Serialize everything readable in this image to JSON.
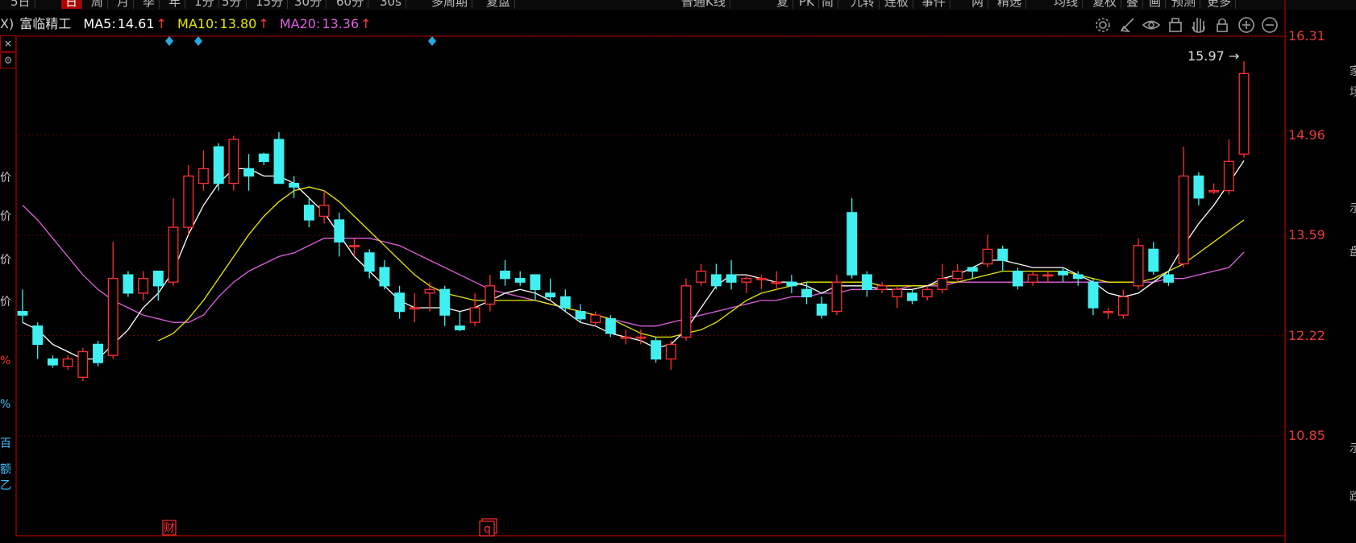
{
  "toolbar": {
    "period_items": [
      "5日",
      "日",
      "周",
      "月",
      "季",
      "年",
      "1分",
      "5分",
      "15分",
      "30分",
      "60分",
      "30s",
      "多周期",
      "复盘"
    ],
    "active_index": 1,
    "right_items": [
      "普通K线",
      "复",
      "PK",
      "简",
      "九转",
      "连板",
      "事件",
      "两",
      "精选",
      "均线",
      "复权",
      "叠",
      "画",
      "预测",
      "更多"
    ]
  },
  "legend": {
    "prefix": "X)",
    "stock_name": "富临精工",
    "ma5_label": "MA5:",
    "ma5_value": "14.61",
    "ma10_label": "MA10:",
    "ma10_value": "13.80",
    "ma20_label": "MA20:",
    "ma20_value": "13.36",
    "arrow": "↑",
    "colors": {
      "ma5": "#ffffff",
      "ma10": "#e8e800",
      "ma20": "#e060e0",
      "arrow": "#ff3b3b",
      "name": "#e0e0e0"
    }
  },
  "icons": [
    "settings-icon",
    "pen-icon",
    "eye-icon",
    "bag-icon",
    "hand-icon",
    "lock-icon",
    "zoom-in-icon",
    "zoom-out-icon"
  ],
  "price_axis": {
    "ticks": [
      "16.31",
      "14.96",
      "13.59",
      "12.22",
      "10.85"
    ]
  },
  "max_marker": "15.97",
  "event_badges": {
    "fin": "财",
    "q": "q"
  },
  "left_column": [
    "价",
    "价",
    "价",
    "价",
    "%",
    "%",
    "百",
    "额",
    "乙"
  ],
  "right_column": [
    "家",
    "场",
    "示",
    "盘",
    "示",
    "跌"
  ],
  "colors": {
    "up": "#ff3030",
    "down": "#40f0f0",
    "grid": "#5a0000",
    "axis_text": "#e23a3a"
  },
  "chart_data": {
    "type": "candlestick",
    "ylim": [
      9.5,
      16.9
    ],
    "candles": [
      [
        12.55,
        12.5,
        12.85,
        12.4
      ],
      [
        12.35,
        12.1,
        12.4,
        11.9
      ],
      [
        11.9,
        11.82,
        11.95,
        11.78
      ],
      [
        11.8,
        11.9,
        11.95,
        11.75
      ],
      [
        11.65,
        12.0,
        12.05,
        11.6
      ],
      [
        12.1,
        11.85,
        12.15,
        11.8
      ],
      [
        11.95,
        13.0,
        13.5,
        11.9
      ],
      [
        13.05,
        12.8,
        13.1,
        12.75
      ],
      [
        12.8,
        13.0,
        13.1,
        12.7
      ],
      [
        13.1,
        12.9,
        13.1,
        12.7
      ],
      [
        12.95,
        13.7,
        14.1,
        12.9
      ],
      [
        13.7,
        14.4,
        14.55,
        13.6
      ],
      [
        14.3,
        14.5,
        14.75,
        14.2
      ],
      [
        14.8,
        14.3,
        14.85,
        14.2
      ],
      [
        14.3,
        14.9,
        14.95,
        14.2
      ],
      [
        14.5,
        14.4,
        14.7,
        14.2
      ],
      [
        14.7,
        14.6,
        14.72,
        14.55
      ],
      [
        14.9,
        14.3,
        15.0,
        14.3
      ],
      [
        14.3,
        14.25,
        14.4,
        14.1
      ],
      [
        14.0,
        13.8,
        14.1,
        13.7
      ],
      [
        13.85,
        14.0,
        14.2,
        13.75
      ],
      [
        13.8,
        13.5,
        13.9,
        13.3
      ],
      [
        13.45,
        13.45,
        13.55,
        13.3
      ],
      [
        13.35,
        13.1,
        13.4,
        13.0
      ],
      [
        13.15,
        12.9,
        13.25,
        12.85
      ],
      [
        12.8,
        12.55,
        12.9,
        12.45
      ],
      [
        12.6,
        12.6,
        12.8,
        12.4
      ],
      [
        12.8,
        12.85,
        12.95,
        12.55
      ],
      [
        12.85,
        12.5,
        12.9,
        12.35
      ],
      [
        12.35,
        12.3,
        12.55,
        12.28
      ],
      [
        12.4,
        12.6,
        12.8,
        12.35
      ],
      [
        12.65,
        12.9,
        13.05,
        12.55
      ],
      [
        13.1,
        13.0,
        13.25,
        12.9
      ],
      [
        13.0,
        12.95,
        13.1,
        12.9
      ],
      [
        13.05,
        12.85,
        13.05,
        12.7
      ],
      [
        12.8,
        12.75,
        13.0,
        12.7
      ],
      [
        12.75,
        12.6,
        12.85,
        12.55
      ],
      [
        12.55,
        12.45,
        12.65,
        12.4
      ],
      [
        12.4,
        12.5,
        12.55,
        12.35
      ],
      [
        12.45,
        12.25,
        12.5,
        12.2
      ],
      [
        12.2,
        12.2,
        12.3,
        12.1
      ],
      [
        12.2,
        12.2,
        12.3,
        12.1
      ],
      [
        12.15,
        11.9,
        12.2,
        11.85
      ],
      [
        11.9,
        12.1,
        12.15,
        11.75
      ],
      [
        12.2,
        12.9,
        13.0,
        12.15
      ],
      [
        12.95,
        13.1,
        13.2,
        12.9
      ],
      [
        13.05,
        12.9,
        13.2,
        12.85
      ],
      [
        13.05,
        12.95,
        13.25,
        12.85
      ],
      [
        12.95,
        13.0,
        13.05,
        12.8
      ],
      [
        13.0,
        13.0,
        13.05,
        12.85
      ],
      [
        12.95,
        12.95,
        13.1,
        12.85
      ],
      [
        12.95,
        12.9,
        13.05,
        12.8
      ],
      [
        12.85,
        12.75,
        12.95,
        12.65
      ],
      [
        12.65,
        12.5,
        12.75,
        12.45
      ],
      [
        12.55,
        12.95,
        13.05,
        12.5
      ],
      [
        13.9,
        13.05,
        14.1,
        13.0
      ],
      [
        13.05,
        12.85,
        13.1,
        12.75
      ],
      [
        12.85,
        12.9,
        12.95,
        12.8
      ],
      [
        12.75,
        12.85,
        12.9,
        12.6
      ],
      [
        12.8,
        12.7,
        12.85,
        12.65
      ],
      [
        12.75,
        12.85,
        12.9,
        12.7
      ],
      [
        12.85,
        13.0,
        13.2,
        12.8
      ],
      [
        13.0,
        13.1,
        13.2,
        12.95
      ],
      [
        13.15,
        13.1,
        13.15,
        13.0
      ],
      [
        13.2,
        13.4,
        13.6,
        13.15
      ],
      [
        13.4,
        13.25,
        13.45,
        13.1
      ],
      [
        13.1,
        12.9,
        13.15,
        12.85
      ],
      [
        12.95,
        13.05,
        13.1,
        12.9
      ],
      [
        13.05,
        13.05,
        13.1,
        12.95
      ],
      [
        13.1,
        13.05,
        13.15,
        12.95
      ],
      [
        13.05,
        13.0,
        13.1,
        12.9
      ],
      [
        12.95,
        12.6,
        13.0,
        12.5
      ],
      [
        12.55,
        12.55,
        12.6,
        12.45
      ],
      [
        12.5,
        12.75,
        12.85,
        12.45
      ],
      [
        12.9,
        13.45,
        13.55,
        12.85
      ],
      [
        13.4,
        13.1,
        13.5,
        13.05
      ],
      [
        13.05,
        12.95,
        13.1,
        12.9
      ],
      [
        13.2,
        14.4,
        14.8,
        13.15
      ],
      [
        14.4,
        14.1,
        14.45,
        14.0
      ],
      [
        14.2,
        14.2,
        14.3,
        14.15
      ],
      [
        14.2,
        14.6,
        14.9,
        14.15
      ],
      [
        14.7,
        15.8,
        15.97,
        14.65
      ]
    ],
    "ma5": [
      12.4,
      12.3,
      12.1,
      12.0,
      11.9,
      11.9,
      12.1,
      12.3,
      12.6,
      12.8,
      13.1,
      13.6,
      14.0,
      14.3,
      14.5,
      14.5,
      14.4,
      14.4,
      14.3,
      14.1,
      13.9,
      13.6,
      13.3,
      13.1,
      12.9,
      12.7,
      12.6,
      12.6,
      12.6,
      12.55,
      12.6,
      12.7,
      12.8,
      12.85,
      12.8,
      12.7,
      12.55,
      12.4,
      12.35,
      12.25,
      12.2,
      12.15,
      12.05,
      12.1,
      12.3,
      12.6,
      12.9,
      13.05,
      13.05,
      13.0,
      12.95,
      12.95,
      12.9,
      12.8,
      12.9,
      12.9,
      12.9,
      12.85,
      12.85,
      12.85,
      12.9,
      13.0,
      13.05,
      13.15,
      13.25,
      13.25,
      13.2,
      13.15,
      13.15,
      13.15,
      13.05,
      12.95,
      12.8,
      12.75,
      12.8,
      12.95,
      13.1,
      13.45,
      13.75,
      14.0,
      14.3,
      14.61
    ],
    "ma10": [
      null,
      null,
      null,
      null,
      null,
      null,
      null,
      null,
      null,
      12.15,
      12.25,
      12.45,
      12.7,
      13.0,
      13.3,
      13.6,
      13.85,
      14.05,
      14.2,
      14.25,
      14.2,
      14.05,
      13.85,
      13.65,
      13.45,
      13.25,
      13.05,
      12.9,
      12.8,
      12.75,
      12.7,
      12.7,
      12.7,
      12.7,
      12.7,
      12.65,
      12.6,
      12.55,
      12.5,
      12.45,
      12.35,
      12.25,
      12.2,
      12.2,
      12.25,
      12.3,
      12.4,
      12.55,
      12.7,
      12.8,
      12.85,
      12.9,
      12.95,
      12.95,
      12.95,
      12.95,
      12.95,
      12.9,
      12.9,
      12.9,
      12.9,
      12.95,
      12.95,
      13.0,
      13.05,
      13.1,
      13.1,
      13.1,
      13.1,
      13.1,
      13.05,
      13.0,
      12.95,
      12.95,
      12.95,
      13.0,
      13.1,
      13.2,
      13.35,
      13.5,
      13.65,
      13.8
    ],
    "ma20": [
      14.0,
      13.8,
      13.55,
      13.3,
      13.05,
      12.85,
      12.7,
      12.6,
      12.5,
      12.45,
      12.4,
      12.4,
      12.5,
      12.75,
      12.95,
      13.1,
      13.2,
      13.3,
      13.35,
      13.45,
      13.55,
      13.55,
      13.55,
      13.55,
      13.5,
      13.45,
      13.35,
      13.25,
      13.15,
      13.05,
      12.95,
      12.85,
      12.8,
      12.75,
      12.7,
      12.65,
      12.6,
      12.55,
      12.5,
      12.45,
      12.4,
      12.35,
      12.35,
      12.4,
      12.45,
      12.5,
      12.55,
      12.6,
      12.65,
      12.7,
      12.7,
      12.75,
      12.75,
      12.8,
      12.8,
      12.85,
      12.85,
      12.85,
      12.85,
      12.9,
      12.9,
      12.9,
      12.95,
      12.95,
      12.95,
      12.95,
      12.95,
      12.95,
      12.95,
      12.95,
      12.95,
      12.95,
      12.95,
      12.95,
      12.95,
      12.95,
      13.0,
      13.0,
      13.05,
      13.1,
      13.15,
      13.36
    ]
  }
}
